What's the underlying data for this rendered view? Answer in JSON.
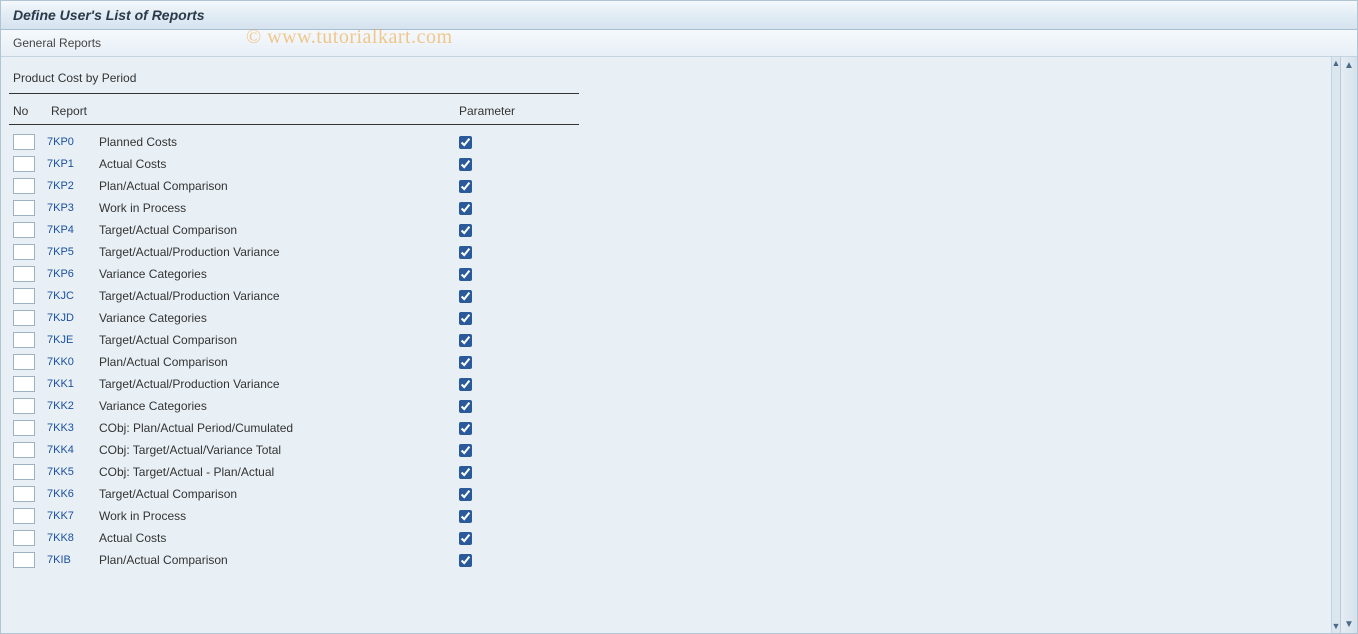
{
  "title": "Define User's List of Reports",
  "toolbar": {
    "general_reports": "General Reports"
  },
  "section": {
    "heading": "Product Cost by Period"
  },
  "headers": {
    "no": "No",
    "report": "Report",
    "parameter": "Parameter"
  },
  "watermark": "© www.tutorialkart.com",
  "rows": [
    {
      "no": "",
      "code": "7KP0",
      "report": "Planned Costs",
      "param": true
    },
    {
      "no": "",
      "code": "7KP1",
      "report": "Actual Costs",
      "param": true
    },
    {
      "no": "",
      "code": "7KP2",
      "report": "Plan/Actual Comparison",
      "param": true
    },
    {
      "no": "",
      "code": "7KP3",
      "report": "Work in Process",
      "param": true
    },
    {
      "no": "",
      "code": "7KP4",
      "report": "Target/Actual Comparison",
      "param": true
    },
    {
      "no": "",
      "code": "7KP5",
      "report": "Target/Actual/Production Variance",
      "param": true
    },
    {
      "no": "",
      "code": "7KP6",
      "report": "Variance Categories",
      "param": true
    },
    {
      "no": "",
      "code": "7KJC",
      "report": "Target/Actual/Production Variance",
      "param": true
    },
    {
      "no": "",
      "code": "7KJD",
      "report": "Variance Categories",
      "param": true
    },
    {
      "no": "",
      "code": "7KJE",
      "report": "Target/Actual Comparison",
      "param": true
    },
    {
      "no": "",
      "code": "7KK0",
      "report": "Plan/Actual Comparison",
      "param": true
    },
    {
      "no": "",
      "code": "7KK1",
      "report": "Target/Actual/Production Variance",
      "param": true
    },
    {
      "no": "",
      "code": "7KK2",
      "report": "Variance Categories",
      "param": true
    },
    {
      "no": "",
      "code": "7KK3",
      "report": "CObj: Plan/Actual Period/Cumulated",
      "param": true
    },
    {
      "no": "",
      "code": "7KK4",
      "report": "CObj: Target/Actual/Variance Total",
      "param": true
    },
    {
      "no": "",
      "code": "7KK5",
      "report": "CObj: Target/Actual - Plan/Actual",
      "param": true
    },
    {
      "no": "",
      "code": "7KK6",
      "report": "Target/Actual Comparison",
      "param": true
    },
    {
      "no": "",
      "code": "7KK7",
      "report": "Work in Process",
      "param": true
    },
    {
      "no": "",
      "code": "7KK8",
      "report": "Actual Costs",
      "param": true
    },
    {
      "no": "",
      "code": "7KIB",
      "report": "Plan/Actual Comparison",
      "param": true
    }
  ]
}
